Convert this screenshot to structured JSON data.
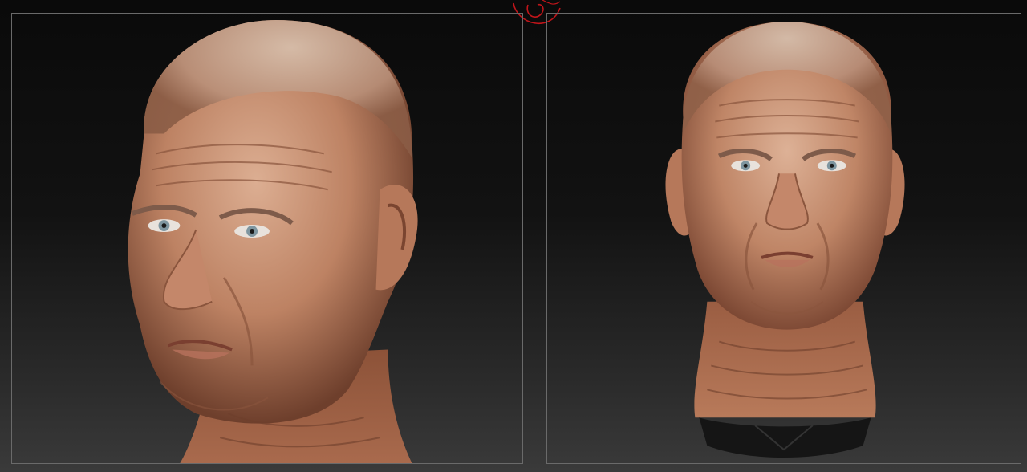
{
  "canvas": {
    "background_top": "#0a0a0a",
    "background_bottom": "#3a3a3a",
    "frame_color": "#6a6a6a"
  },
  "viewports": [
    {
      "id": "left",
      "view": "three-quarter",
      "content": "head-render"
    },
    {
      "id": "right",
      "view": "front",
      "content": "head-render"
    }
  ],
  "gizmo": {
    "icon": "rotation-gizmo-icon",
    "color": "#c0151a"
  },
  "skin_colors": {
    "light": "#d9a98c",
    "mid": "#b5795a",
    "dark": "#6e3f2c",
    "eye": "#7f96a0"
  }
}
